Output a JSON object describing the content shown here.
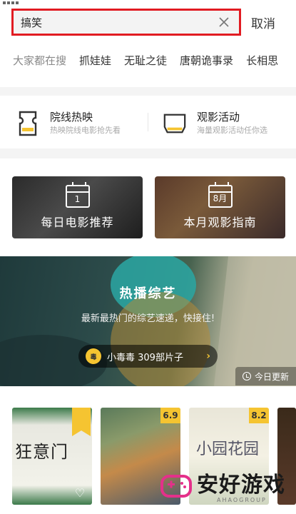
{
  "search": {
    "value": "搞笑",
    "cancel_label": "取消"
  },
  "hot_search": {
    "label": "大家都在搜",
    "items": [
      "抓娃娃",
      "无耻之徒",
      "唐朝诡事录",
      "长相思"
    ]
  },
  "features": [
    {
      "title": "院线热映",
      "subtitle": "热映院线电影抢先看",
      "icon": "ticket-icon"
    },
    {
      "title": "观影活动",
      "subtitle": "海量观影活动任你选",
      "icon": "cinema-screen-icon"
    }
  ],
  "guides": [
    {
      "calendar": "1",
      "title": "每日电影推荐",
      "icon": "calendar-icon"
    },
    {
      "calendar": "8月",
      "title": "本月观影指南",
      "icon": "calendar-icon"
    }
  ],
  "banner": {
    "title": "热播综艺",
    "subtitle": "最新最热门的综艺速递，快接住!",
    "pill_avatar_text": "毒",
    "pill_text": "小毒毒  309部片子",
    "update_label": "今日更新"
  },
  "posters": [
    {
      "score": "",
      "text": "狂意门"
    },
    {
      "score": "6.9",
      "text": ""
    },
    {
      "score": "8.2",
      "text": "小园花园"
    }
  ],
  "watermark": {
    "text": "安好游戏",
    "sub": "AHAOGROUP"
  },
  "colors": {
    "accent_red": "#e11b22",
    "accent_yellow": "#f5c431"
  }
}
